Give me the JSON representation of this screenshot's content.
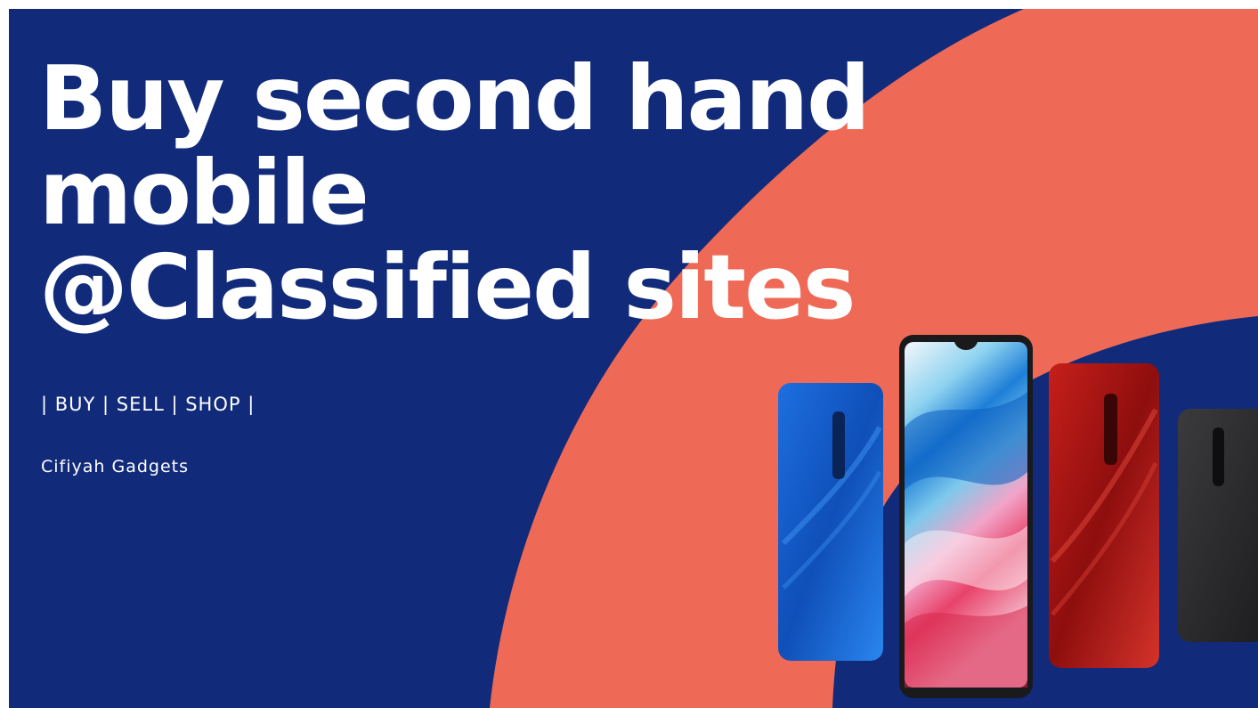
{
  "colors": {
    "navy": "#112b7a",
    "coral": "#ef6a56",
    "text": "#ffffff"
  },
  "headline": {
    "line1": "Buy second hand",
    "line2": "mobile",
    "line3": "@Classified sites"
  },
  "tagline": "| BUY | SELL | SHOP |",
  "brand": "Cifiyah Gadgets",
  "phones": [
    {
      "name": "phone-blue-back",
      "color": "blue"
    },
    {
      "name": "phone-front-screen",
      "color": "black"
    },
    {
      "name": "phone-red-back",
      "color": "red"
    },
    {
      "name": "phone-black-back",
      "color": "black"
    }
  ]
}
